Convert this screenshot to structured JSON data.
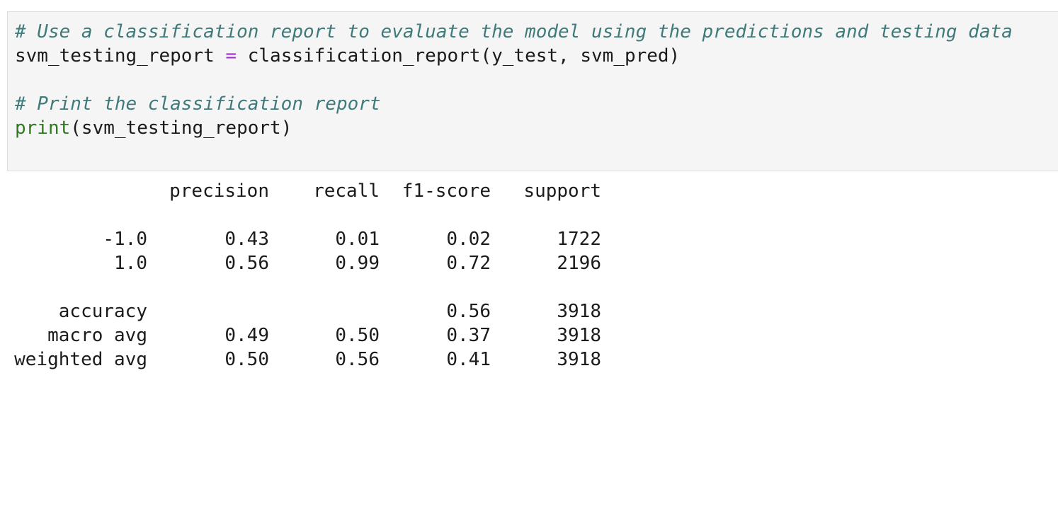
{
  "code": {
    "comment1": "# Use a classification report to evaluate the model using the predictions and testing data",
    "line2": {
      "lhs": "svm_testing_report ",
      "op": "=",
      "rhs": " classification_report(y_test, svm_pred)"
    },
    "comment2": "# Print the classification report",
    "line5": {
      "fn": "print",
      "args": "(svm_testing_report)"
    }
  },
  "report": {
    "headers": [
      "",
      "precision",
      "recall",
      "f1-score",
      "support"
    ],
    "class_rows": [
      [
        "-1.0",
        "0.43",
        "0.01",
        "0.02",
        "1722"
      ],
      [
        "1.0",
        "0.56",
        "0.99",
        "0.72",
        "2196"
      ]
    ],
    "summary_rows": [
      [
        "accuracy",
        "",
        "",
        "0.56",
        "3918"
      ],
      [
        "macro avg",
        "0.49",
        "0.50",
        "0.37",
        "3918"
      ],
      [
        "weighted avg",
        "0.50",
        "0.56",
        "0.41",
        "3918"
      ]
    ]
  }
}
